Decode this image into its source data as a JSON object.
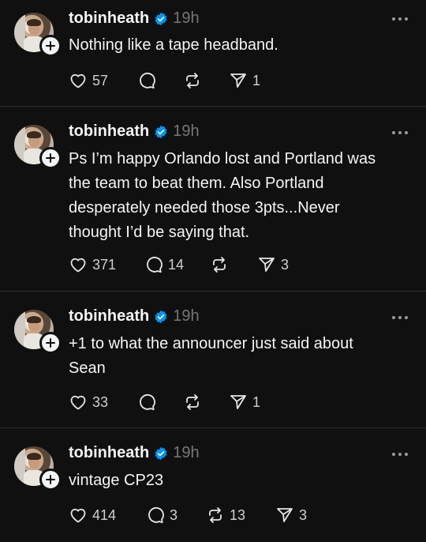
{
  "posts": [
    {
      "username": "tobinheath",
      "time": "19h",
      "text_lines": [
        "Nothing like a tape headband."
      ],
      "likes": "57",
      "replies": "",
      "reposts": "",
      "shares": "1"
    },
    {
      "username": "tobinheath",
      "time": "19h",
      "text_lines": [
        "Ps I’m happy Orlando lost and Portland was",
        "the team to beat them. Also Portland",
        "desperately needed those 3pts...Never",
        "thought I’d be saying that."
      ],
      "likes": "371",
      "replies": "14",
      "reposts": "",
      "shares": "3"
    },
    {
      "username": "tobinheath",
      "time": "19h",
      "text_lines": [
        "+1 to what the announcer just said about",
        "Sean"
      ],
      "likes": "33",
      "replies": "",
      "reposts": "",
      "shares": "1"
    },
    {
      "username": "tobinheath",
      "time": "19h",
      "text_lines": [
        "vintage CP23"
      ],
      "likes": "414",
      "replies": "3",
      "reposts": "13",
      "shares": "3"
    }
  ],
  "icons": {
    "like": "heart-icon",
    "reply": "speech-bubble-icon",
    "repost": "repost-arrows-icon",
    "share": "paper-plane-icon",
    "more": "more-dots-icon",
    "verified": "verified-badge-icon",
    "follow": "plus-icon"
  },
  "colors": {
    "background": "#101010",
    "text": "#f3f5f7",
    "muted": "#777777",
    "verified": "#0095f6",
    "divider": "#2e2e2e"
  }
}
